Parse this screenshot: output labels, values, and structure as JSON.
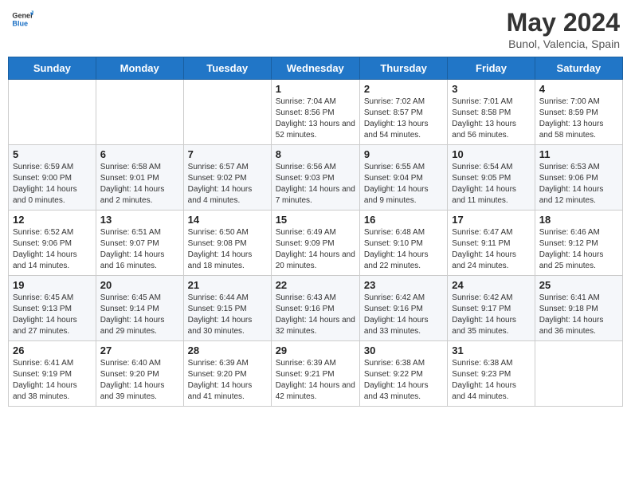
{
  "header": {
    "logo_general": "General",
    "logo_blue": "Blue",
    "month_year": "May 2024",
    "location": "Bunol, Valencia, Spain"
  },
  "days_of_week": [
    "Sunday",
    "Monday",
    "Tuesday",
    "Wednesday",
    "Thursday",
    "Friday",
    "Saturday"
  ],
  "weeks": [
    [
      {
        "day": "",
        "info": ""
      },
      {
        "day": "",
        "info": ""
      },
      {
        "day": "",
        "info": ""
      },
      {
        "day": "1",
        "info": "Sunrise: 7:04 AM\nSunset: 8:56 PM\nDaylight: 13 hours and 52 minutes."
      },
      {
        "day": "2",
        "info": "Sunrise: 7:02 AM\nSunset: 8:57 PM\nDaylight: 13 hours and 54 minutes."
      },
      {
        "day": "3",
        "info": "Sunrise: 7:01 AM\nSunset: 8:58 PM\nDaylight: 13 hours and 56 minutes."
      },
      {
        "day": "4",
        "info": "Sunrise: 7:00 AM\nSunset: 8:59 PM\nDaylight: 13 hours and 58 minutes."
      }
    ],
    [
      {
        "day": "5",
        "info": "Sunrise: 6:59 AM\nSunset: 9:00 PM\nDaylight: 14 hours and 0 minutes."
      },
      {
        "day": "6",
        "info": "Sunrise: 6:58 AM\nSunset: 9:01 PM\nDaylight: 14 hours and 2 minutes."
      },
      {
        "day": "7",
        "info": "Sunrise: 6:57 AM\nSunset: 9:02 PM\nDaylight: 14 hours and 4 minutes."
      },
      {
        "day": "8",
        "info": "Sunrise: 6:56 AM\nSunset: 9:03 PM\nDaylight: 14 hours and 7 minutes."
      },
      {
        "day": "9",
        "info": "Sunrise: 6:55 AM\nSunset: 9:04 PM\nDaylight: 14 hours and 9 minutes."
      },
      {
        "day": "10",
        "info": "Sunrise: 6:54 AM\nSunset: 9:05 PM\nDaylight: 14 hours and 11 minutes."
      },
      {
        "day": "11",
        "info": "Sunrise: 6:53 AM\nSunset: 9:06 PM\nDaylight: 14 hours and 12 minutes."
      }
    ],
    [
      {
        "day": "12",
        "info": "Sunrise: 6:52 AM\nSunset: 9:06 PM\nDaylight: 14 hours and 14 minutes."
      },
      {
        "day": "13",
        "info": "Sunrise: 6:51 AM\nSunset: 9:07 PM\nDaylight: 14 hours and 16 minutes."
      },
      {
        "day": "14",
        "info": "Sunrise: 6:50 AM\nSunset: 9:08 PM\nDaylight: 14 hours and 18 minutes."
      },
      {
        "day": "15",
        "info": "Sunrise: 6:49 AM\nSunset: 9:09 PM\nDaylight: 14 hours and 20 minutes."
      },
      {
        "day": "16",
        "info": "Sunrise: 6:48 AM\nSunset: 9:10 PM\nDaylight: 14 hours and 22 minutes."
      },
      {
        "day": "17",
        "info": "Sunrise: 6:47 AM\nSunset: 9:11 PM\nDaylight: 14 hours and 24 minutes."
      },
      {
        "day": "18",
        "info": "Sunrise: 6:46 AM\nSunset: 9:12 PM\nDaylight: 14 hours and 25 minutes."
      }
    ],
    [
      {
        "day": "19",
        "info": "Sunrise: 6:45 AM\nSunset: 9:13 PM\nDaylight: 14 hours and 27 minutes."
      },
      {
        "day": "20",
        "info": "Sunrise: 6:45 AM\nSunset: 9:14 PM\nDaylight: 14 hours and 29 minutes."
      },
      {
        "day": "21",
        "info": "Sunrise: 6:44 AM\nSunset: 9:15 PM\nDaylight: 14 hours and 30 minutes."
      },
      {
        "day": "22",
        "info": "Sunrise: 6:43 AM\nSunset: 9:16 PM\nDaylight: 14 hours and 32 minutes."
      },
      {
        "day": "23",
        "info": "Sunrise: 6:42 AM\nSunset: 9:16 PM\nDaylight: 14 hours and 33 minutes."
      },
      {
        "day": "24",
        "info": "Sunrise: 6:42 AM\nSunset: 9:17 PM\nDaylight: 14 hours and 35 minutes."
      },
      {
        "day": "25",
        "info": "Sunrise: 6:41 AM\nSunset: 9:18 PM\nDaylight: 14 hours and 36 minutes."
      }
    ],
    [
      {
        "day": "26",
        "info": "Sunrise: 6:41 AM\nSunset: 9:19 PM\nDaylight: 14 hours and 38 minutes."
      },
      {
        "day": "27",
        "info": "Sunrise: 6:40 AM\nSunset: 9:20 PM\nDaylight: 14 hours and 39 minutes."
      },
      {
        "day": "28",
        "info": "Sunrise: 6:39 AM\nSunset: 9:20 PM\nDaylight: 14 hours and 41 minutes."
      },
      {
        "day": "29",
        "info": "Sunrise: 6:39 AM\nSunset: 9:21 PM\nDaylight: 14 hours and 42 minutes."
      },
      {
        "day": "30",
        "info": "Sunrise: 6:38 AM\nSunset: 9:22 PM\nDaylight: 14 hours and 43 minutes."
      },
      {
        "day": "31",
        "info": "Sunrise: 6:38 AM\nSunset: 9:23 PM\nDaylight: 14 hours and 44 minutes."
      },
      {
        "day": "",
        "info": ""
      }
    ]
  ]
}
